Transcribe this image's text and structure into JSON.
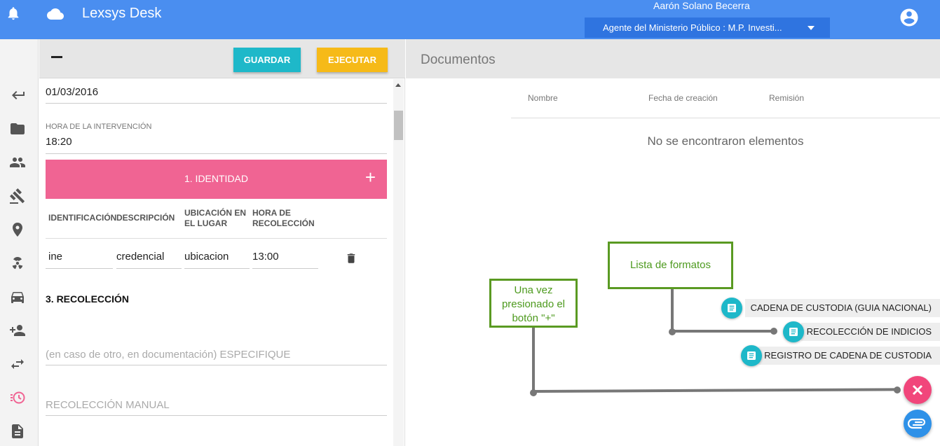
{
  "header": {
    "app_title": "Lexsys Desk",
    "user_name": "Aarón Solano Becerra",
    "role": "Agente del Ministerio Público : M.P. Investi..."
  },
  "nav": {
    "icons": [
      "back-arrow-icon",
      "folder-icon",
      "people-icon",
      "gavel-icon",
      "location-pin-icon",
      "hazard-icon",
      "car-icon",
      "add-person-icon",
      "swap-icon",
      "history-icon",
      "document-icon"
    ]
  },
  "form": {
    "toolbar": {
      "save_label": "GUARDAR",
      "execute_label": "EJECUTAR"
    },
    "date_value": "01/03/2016",
    "time_label": "HORA DE LA INTERVENCIÓN",
    "time_value": "18:20",
    "identity_section": "1. IDENTIDAD",
    "identity_add": "+",
    "table": {
      "headers": [
        "IDENTIFICACIÓN",
        "DESCRIPCIÓN",
        "UBICACIÓN EN EL LUGAR",
        "HORA DE RECOLECCIÓN"
      ],
      "row": [
        "ine",
        "credencial",
        "ubicacion",
        "13:00"
      ]
    },
    "collection_section": "3. RECOLECCIÓN",
    "specify_placeholder": "(en caso de otro, en documentación) ESPECIFIQUE",
    "manual_placeholder": "RECOLECCIÓN MANUAL"
  },
  "documents": {
    "title": "Documentos",
    "columns": [
      "Nombre",
      "Fecha de creación",
      "Remisión"
    ],
    "empty_message": "No se encontraron elementos"
  },
  "annotations": {
    "formats_list": "Lista de formatos",
    "pressed_plus": "Una vez presionado el botón \"+\""
  },
  "fab_menu": {
    "items": [
      "CADENA DE CUSTODIA (GUIA NACIONAL)",
      "RECOLECCIÓN DE INDICIOS",
      "REGISTRO DE CADENA DE CUSTODIA"
    ]
  },
  "colors": {
    "topbar": "#4a8ef0",
    "accent_pink": "#f06493",
    "save_button": "#1eb8c9",
    "execute_button": "#f6ba18",
    "annotation_green": "#5a9a22"
  }
}
